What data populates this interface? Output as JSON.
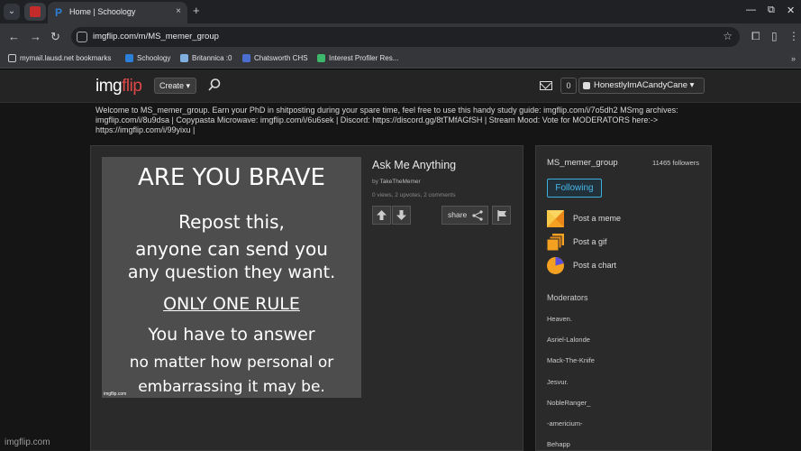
{
  "browser": {
    "tab_active_title": "Home | Schoology",
    "tab_close": "×",
    "new_tab": "+",
    "url": "imgflip.com/m/MS_memer_group",
    "window_controls": {
      "minimize": "—",
      "restore": "⧉",
      "close": "✕"
    },
    "bookmarks": [
      {
        "label": "mymail.lausd.net bookmarks",
        "icon": "folder-icon",
        "color": "#c8cacd"
      },
      {
        "label": "Schoology",
        "icon": "schoology-icon",
        "color": "#2b7fd6"
      },
      {
        "label": "Britannica :0",
        "icon": "britannica-icon",
        "color": "#7fb0e0"
      },
      {
        "label": "Chatsworth CHS",
        "icon": "school-icon",
        "color": "#4a6fd0"
      },
      {
        "label": "Interest Profiler Res...",
        "icon": "profiler-icon",
        "color": "#3db86a"
      }
    ],
    "bookmarks_more": "»"
  },
  "site": {
    "logo_img": "img",
    "logo_flip": "flip",
    "create_label": "Create ▾",
    "notification_count": "0",
    "username": "HonestlyImACandyCane ▾"
  },
  "stream": {
    "description": "Welcome to MS_memer_group. Earn your PhD in shitposting during your spare time, feel free to use this handy study guide: imgflip.com/i/7o5dh2 MSmg archives: imgflip.com/i/8u9dsa | Copypasta Microwave: imgflip.com/i/6u6sek | Discord: https://discord.gg/8tTMfAGfSH | Stream Mood: Vote for MODERATORS here:-> https://imgflip.com/i/99yixu |",
    "name": "MS_memer_group",
    "followers": "11465 followers",
    "following_label": "Following",
    "actions": [
      {
        "label": "Post a meme",
        "icon": "post-meme-icon"
      },
      {
        "label": "Post a gif",
        "icon": "post-gif-icon"
      },
      {
        "label": "Post a chart",
        "icon": "post-chart-icon"
      }
    ],
    "moderators_header": "Moderators",
    "moderators": [
      "Heaven.",
      "Asriel-Lalonde",
      "Mack-The-Knife",
      "Jesvur.",
      "NobleRanger_",
      "-americium-",
      "Behapp"
    ]
  },
  "post": {
    "title": "Ask Me Anything",
    "by_prefix": "by ",
    "author": "TakeTheMemer",
    "stats": "0 views, 2 upvotes, 2 comments",
    "share_label": "share",
    "meme_lines": [
      "ARE YOU BRAVE",
      "Repost this,",
      "anyone can send you",
      "any question they want.",
      "ONLY ONE RULE",
      "You have to answer",
      "no matter how personal or",
      "embarrassing it may be."
    ],
    "image_watermark": "imgflip.com"
  },
  "footer_watermark": "imgflip.com"
}
